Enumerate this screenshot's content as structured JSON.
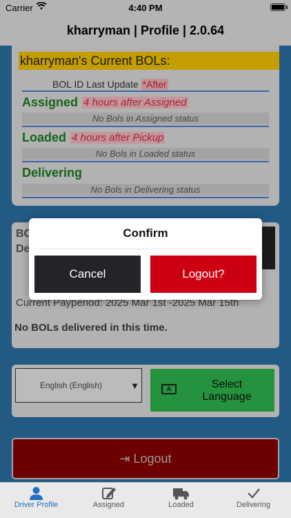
{
  "status_bar": {
    "carrier": "Carrier",
    "time": "4:40 PM"
  },
  "header": {
    "title": "kharryman | Profile | 2.0.64"
  },
  "bols": {
    "title": "kharryman's Current BOLs:",
    "header_label": "BOL ID Last Update",
    "header_after": "*After",
    "sections": [
      {
        "label": "Assigned",
        "note": "4 hours after Assigned",
        "empty": "No Bols in Assigned status"
      },
      {
        "label": "Loaded",
        "note": "4 hours after Pickup",
        "empty": "No Bols in Loaded status"
      },
      {
        "label": "Delivering",
        "note": "",
        "empty": "No Bols in Delivering status"
      }
    ]
  },
  "payperiod": {
    "partial_top": "BO",
    "partial_second": "De",
    "current": "Current Payperiod: 2025 Mar 1st -2025 Mar 15th",
    "no_bols": "No BOLs delivered in this time."
  },
  "language": {
    "selected": "English (English)",
    "button_label": "Select Language"
  },
  "logout": {
    "label": "Logout"
  },
  "dialog": {
    "title": "Confirm",
    "cancel": "Cancel",
    "confirm": "Logout?"
  },
  "tabs": [
    {
      "label": "Driver Profile",
      "icon": "person-icon",
      "active": true
    },
    {
      "label": "Assigned",
      "icon": "edit-icon",
      "active": false
    },
    {
      "label": "Loaded",
      "icon": "truck-icon",
      "active": false
    },
    {
      "label": "Delivering",
      "icon": "check-icon",
      "active": false
    }
  ],
  "colors": {
    "accent": "#2a6ea0",
    "brand_red": "#cc0010",
    "green": "#1a7a1a",
    "active_tab": "#1f6fc4"
  }
}
